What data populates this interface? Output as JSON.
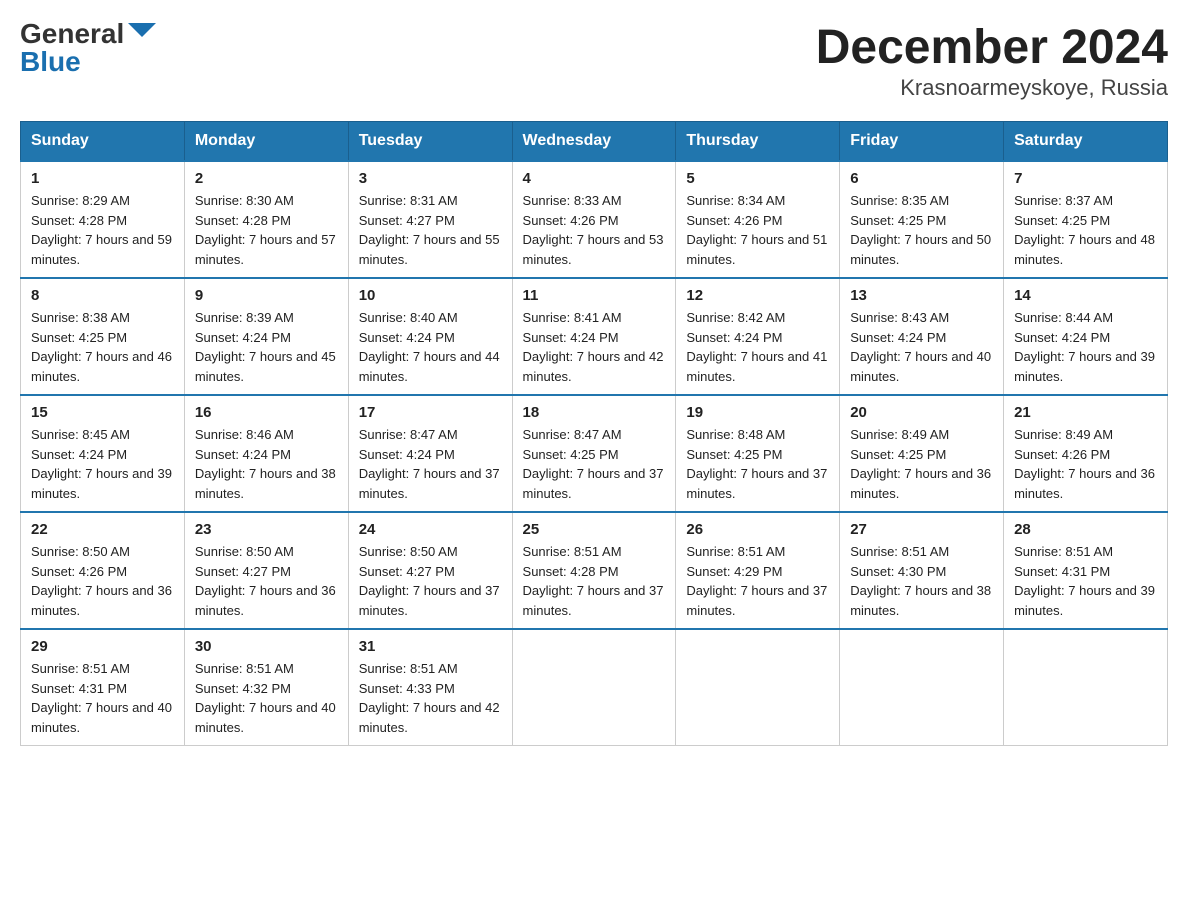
{
  "logo": {
    "general": "General",
    "blue": "Blue",
    "tagline": ""
  },
  "title": "December 2024",
  "subtitle": "Krasnoarmeyskoye, Russia",
  "headers": [
    "Sunday",
    "Monday",
    "Tuesday",
    "Wednesday",
    "Thursday",
    "Friday",
    "Saturday"
  ],
  "weeks": [
    [
      {
        "day": "1",
        "sunrise": "8:29 AM",
        "sunset": "4:28 PM",
        "daylight": "7 hours and 59 minutes."
      },
      {
        "day": "2",
        "sunrise": "8:30 AM",
        "sunset": "4:28 PM",
        "daylight": "7 hours and 57 minutes."
      },
      {
        "day": "3",
        "sunrise": "8:31 AM",
        "sunset": "4:27 PM",
        "daylight": "7 hours and 55 minutes."
      },
      {
        "day": "4",
        "sunrise": "8:33 AM",
        "sunset": "4:26 PM",
        "daylight": "7 hours and 53 minutes."
      },
      {
        "day": "5",
        "sunrise": "8:34 AM",
        "sunset": "4:26 PM",
        "daylight": "7 hours and 51 minutes."
      },
      {
        "day": "6",
        "sunrise": "8:35 AM",
        "sunset": "4:25 PM",
        "daylight": "7 hours and 50 minutes."
      },
      {
        "day": "7",
        "sunrise": "8:37 AM",
        "sunset": "4:25 PM",
        "daylight": "7 hours and 48 minutes."
      }
    ],
    [
      {
        "day": "8",
        "sunrise": "8:38 AM",
        "sunset": "4:25 PM",
        "daylight": "7 hours and 46 minutes."
      },
      {
        "day": "9",
        "sunrise": "8:39 AM",
        "sunset": "4:24 PM",
        "daylight": "7 hours and 45 minutes."
      },
      {
        "day": "10",
        "sunrise": "8:40 AM",
        "sunset": "4:24 PM",
        "daylight": "7 hours and 44 minutes."
      },
      {
        "day": "11",
        "sunrise": "8:41 AM",
        "sunset": "4:24 PM",
        "daylight": "7 hours and 42 minutes."
      },
      {
        "day": "12",
        "sunrise": "8:42 AM",
        "sunset": "4:24 PM",
        "daylight": "7 hours and 41 minutes."
      },
      {
        "day": "13",
        "sunrise": "8:43 AM",
        "sunset": "4:24 PM",
        "daylight": "7 hours and 40 minutes."
      },
      {
        "day": "14",
        "sunrise": "8:44 AM",
        "sunset": "4:24 PM",
        "daylight": "7 hours and 39 minutes."
      }
    ],
    [
      {
        "day": "15",
        "sunrise": "8:45 AM",
        "sunset": "4:24 PM",
        "daylight": "7 hours and 39 minutes."
      },
      {
        "day": "16",
        "sunrise": "8:46 AM",
        "sunset": "4:24 PM",
        "daylight": "7 hours and 38 minutes."
      },
      {
        "day": "17",
        "sunrise": "8:47 AM",
        "sunset": "4:24 PM",
        "daylight": "7 hours and 37 minutes."
      },
      {
        "day": "18",
        "sunrise": "8:47 AM",
        "sunset": "4:25 PM",
        "daylight": "7 hours and 37 minutes."
      },
      {
        "day": "19",
        "sunrise": "8:48 AM",
        "sunset": "4:25 PM",
        "daylight": "7 hours and 37 minutes."
      },
      {
        "day": "20",
        "sunrise": "8:49 AM",
        "sunset": "4:25 PM",
        "daylight": "7 hours and 36 minutes."
      },
      {
        "day": "21",
        "sunrise": "8:49 AM",
        "sunset": "4:26 PM",
        "daylight": "7 hours and 36 minutes."
      }
    ],
    [
      {
        "day": "22",
        "sunrise": "8:50 AM",
        "sunset": "4:26 PM",
        "daylight": "7 hours and 36 minutes."
      },
      {
        "day": "23",
        "sunrise": "8:50 AM",
        "sunset": "4:27 PM",
        "daylight": "7 hours and 36 minutes."
      },
      {
        "day": "24",
        "sunrise": "8:50 AM",
        "sunset": "4:27 PM",
        "daylight": "7 hours and 37 minutes."
      },
      {
        "day": "25",
        "sunrise": "8:51 AM",
        "sunset": "4:28 PM",
        "daylight": "7 hours and 37 minutes."
      },
      {
        "day": "26",
        "sunrise": "8:51 AM",
        "sunset": "4:29 PM",
        "daylight": "7 hours and 37 minutes."
      },
      {
        "day": "27",
        "sunrise": "8:51 AM",
        "sunset": "4:30 PM",
        "daylight": "7 hours and 38 minutes."
      },
      {
        "day": "28",
        "sunrise": "8:51 AM",
        "sunset": "4:31 PM",
        "daylight": "7 hours and 39 minutes."
      }
    ],
    [
      {
        "day": "29",
        "sunrise": "8:51 AM",
        "sunset": "4:31 PM",
        "daylight": "7 hours and 40 minutes."
      },
      {
        "day": "30",
        "sunrise": "8:51 AM",
        "sunset": "4:32 PM",
        "daylight": "7 hours and 40 minutes."
      },
      {
        "day": "31",
        "sunrise": "8:51 AM",
        "sunset": "4:33 PM",
        "daylight": "7 hours and 42 minutes."
      },
      null,
      null,
      null,
      null
    ]
  ]
}
